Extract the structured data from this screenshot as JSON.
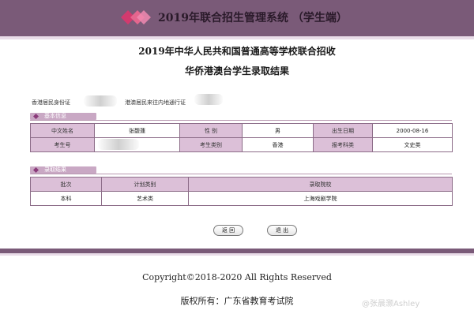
{
  "header": {
    "title": "2019年联合招生管理系统 （学生端）",
    "brand_color": "#7a5a78"
  },
  "page": {
    "title_line1": "2019年中华人民共和国普通高等学校联合招收",
    "title_line2": "华侨港澳台学生录取结果"
  },
  "id_info": {
    "hk_id_label": "香港居民身份证",
    "permit_label": "港澳居民来往内地通行证"
  },
  "basic_section": {
    "title": "基本信息",
    "rows": [
      [
        {
          "label": "中文姓名"
        },
        {
          "value": "张馥蓮"
        },
        {
          "label": "性 别"
        },
        {
          "value": "男"
        },
        {
          "label": "出生日期"
        },
        {
          "value": "2000-08-16"
        }
      ],
      [
        {
          "label": "考生号"
        },
        {
          "value": ""
        },
        {
          "label": "考生类别"
        },
        {
          "value": "香港"
        },
        {
          "label": "报考科类"
        },
        {
          "value": "文史类"
        }
      ]
    ]
  },
  "admission_section": {
    "title": "录取结果",
    "headers": [
      "批次",
      "计划类别",
      "录取院校"
    ],
    "rows": [
      [
        "本科",
        "艺术类",
        "上海戏剧学院"
      ]
    ]
  },
  "buttons": {
    "back": "返 回",
    "exit": "退 出"
  },
  "footer": {
    "copyright": "Copyright©2018-2020 All Rights Reserved",
    "owner": "版权所有：广东省教育考试院"
  },
  "watermark": "@张晨灏Ashley"
}
